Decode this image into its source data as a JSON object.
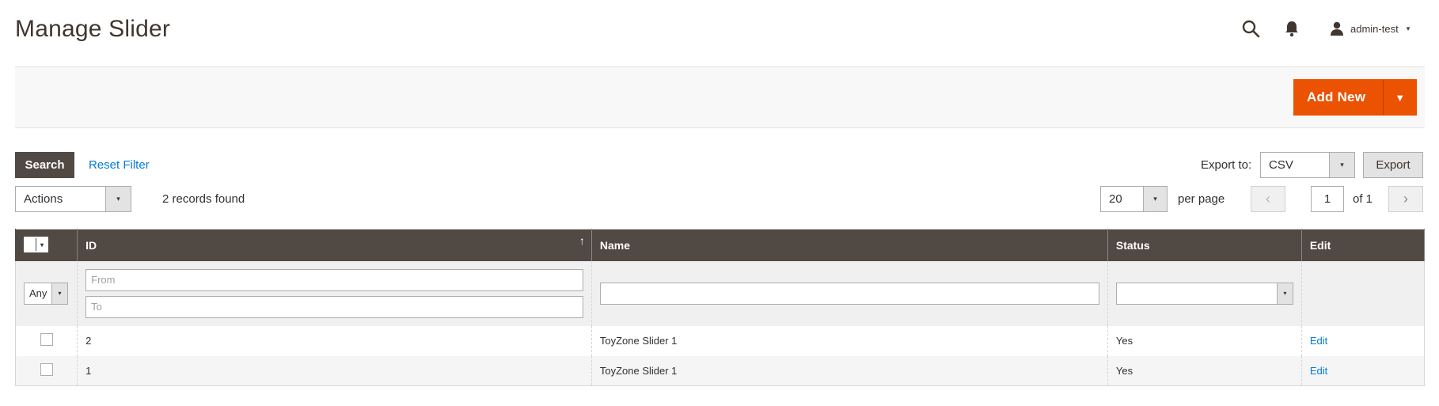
{
  "page": {
    "title": "Manage Slider"
  },
  "header": {
    "search_icon": "search-icon",
    "bell_icon": "bell-icon",
    "user_icon": "user-icon",
    "username": "admin-test",
    "caret": "▾"
  },
  "toolbar": {
    "add_new_label": "Add New",
    "split_arrow": "▼"
  },
  "filters": {
    "search_label": "Search",
    "reset_label": "Reset Filter",
    "export_label": "Export to:",
    "export_format": "CSV",
    "export_button": "Export",
    "actions_label": "Actions",
    "records_found": "2 records found",
    "per_page_value": "20",
    "per_page_label": "per page",
    "page_current": "1",
    "page_total": "of 1",
    "prev_arrow": "‹",
    "next_arrow": "›",
    "select_arrow": "▾"
  },
  "grid": {
    "columns": [
      "ID",
      "Name",
      "Status",
      "Edit"
    ],
    "sort_indicator": "↑",
    "filter": {
      "massaction_value": "Any",
      "id_from_placeholder": "From",
      "id_to_placeholder": "To",
      "name_value": "",
      "status_value": ""
    },
    "rows": [
      {
        "id": "2",
        "name": "ToyZone Slider 1",
        "status": "Yes",
        "edit": "Edit"
      },
      {
        "id": "1",
        "name": "ToyZone Slider 1",
        "status": "Yes",
        "edit": "Edit"
      }
    ]
  },
  "colors": {
    "accent": "#eb5202",
    "header_bg": "#514943",
    "link": "#007bdb"
  }
}
